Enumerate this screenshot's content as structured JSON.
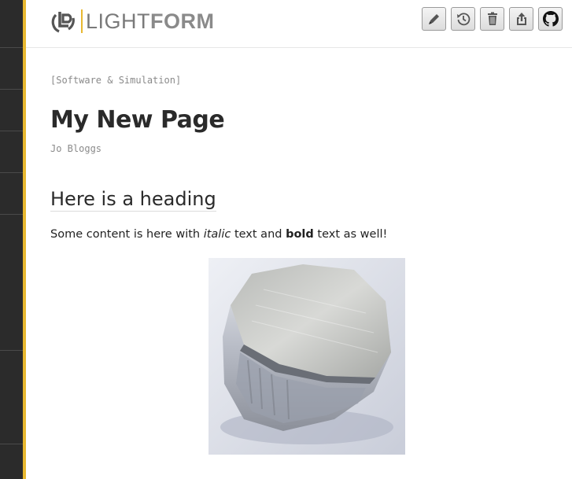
{
  "header": {
    "logo": {
      "text_light": "LIGHT",
      "text_bold": "FORM"
    },
    "toolbar": [
      {
        "name": "edit-button",
        "icon": "pencil-icon"
      },
      {
        "name": "history-button",
        "icon": "history-icon"
      },
      {
        "name": "delete-button",
        "icon": "trash-icon"
      },
      {
        "name": "export-button",
        "icon": "upload-icon"
      },
      {
        "name": "github-button",
        "icon": "github-icon"
      }
    ]
  },
  "page": {
    "category": "[Software & Simulation]",
    "title": "My New Page",
    "author": "Jo Bloggs",
    "heading": "Here is a heading",
    "paragraph": {
      "part1": "Some content is here with ",
      "italic": "italic",
      "part2": " text and ",
      "bold": "bold",
      "part3": " text as well!"
    }
  },
  "figure": {
    "subject": "metal-sample-photo"
  },
  "colors": {
    "sidebar": "#2b2b2b",
    "accent": "#e8b830",
    "text": "#222222",
    "muted": "#8a8a8a"
  }
}
